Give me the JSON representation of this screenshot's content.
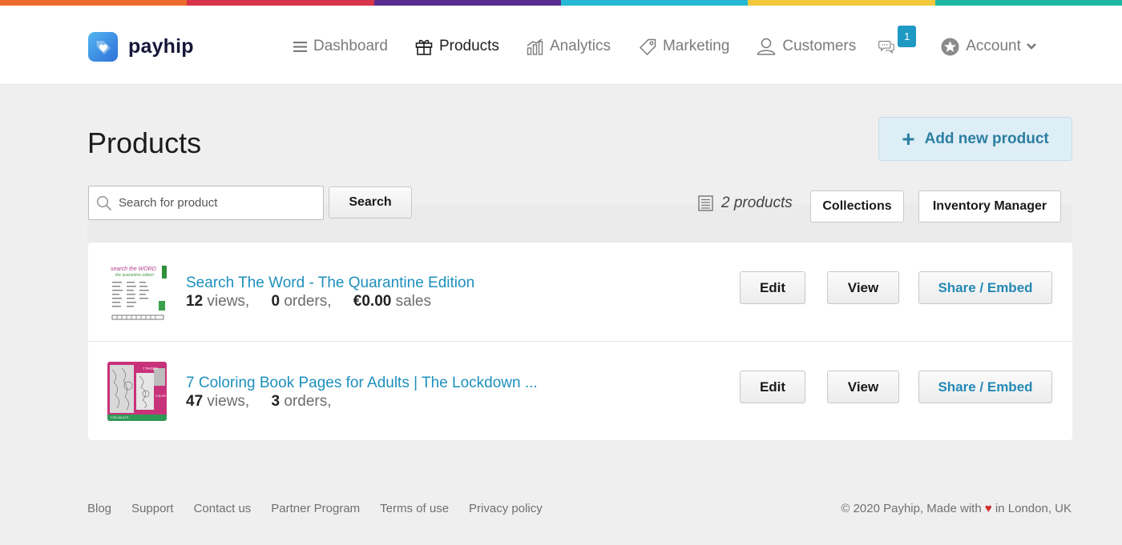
{
  "colors": {
    "rainbow": [
      "#ee6b2f",
      "#d8344a",
      "#5a2d91",
      "#27b9d3",
      "#f3c83a",
      "#1fb9a3"
    ],
    "accent": "#1e99c4",
    "link": "#1d90bd"
  },
  "brand": {
    "name": "payhip"
  },
  "nav": {
    "dashboard": "Dashboard",
    "products": "Products",
    "analytics": "Analytics",
    "marketing": "Marketing",
    "customers": "Customers",
    "messages_badge": "1",
    "account": "Account"
  },
  "page": {
    "title": "Products",
    "add_button": "Add new product",
    "add_icon": "+"
  },
  "search": {
    "placeholder": "Search for product",
    "value": "",
    "button": "Search"
  },
  "toolbar": {
    "product_count": "2 products",
    "collections": "Collections",
    "inventory": "Inventory Manager"
  },
  "products": [
    {
      "title": "Search The Word - The Quarantine Edition",
      "views_num": "12",
      "views_label": "views,",
      "orders_num": "0",
      "orders_label": "orders,",
      "sales_num": "€0.00",
      "sales_label": "sales",
      "thumb_icon": "wordsearch-thumbnail",
      "edit": "Edit",
      "view": "View",
      "share": "Share / Embed"
    },
    {
      "title": "7 Coloring Book Pages for Adults | The Lockdown ...",
      "views_num": "47",
      "views_label": "views,",
      "orders_num": "3",
      "orders_label": "orders,",
      "thumb_icon": "coloring-book-thumbnail",
      "edit": "Edit",
      "view": "View",
      "share": "Share / Embed"
    }
  ],
  "footer": {
    "links": [
      "Blog",
      "Support",
      "Contact us",
      "Partner Program",
      "Terms of use",
      "Privacy policy"
    ],
    "copyright_pre": "© 2020 Payhip, Made with",
    "heart": "♥",
    "copyright_post": "in London, UK"
  }
}
